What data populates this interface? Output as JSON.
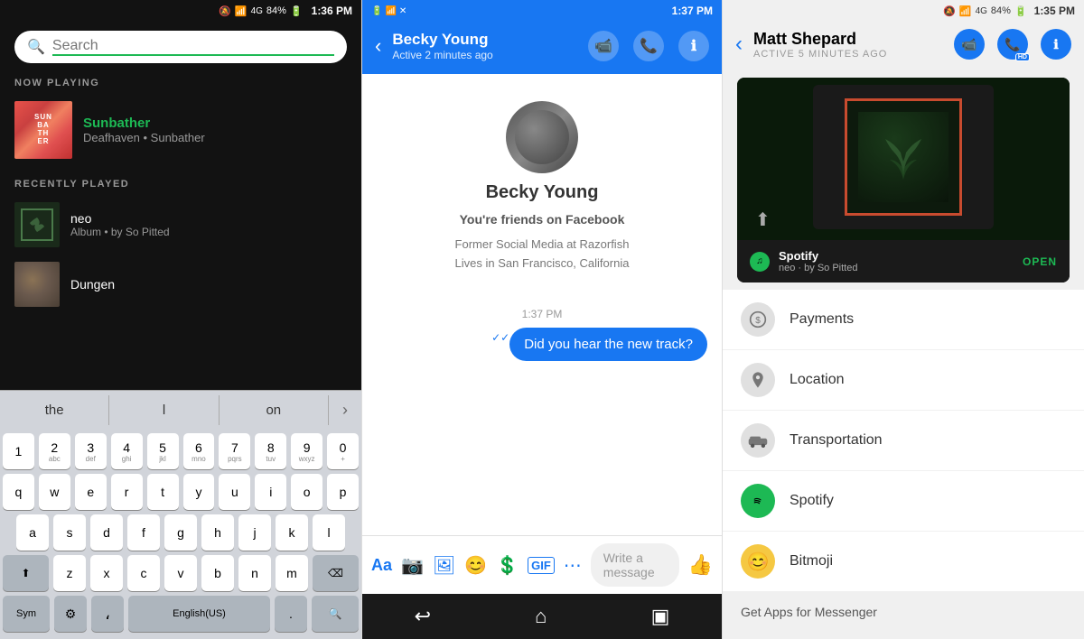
{
  "spotify": {
    "status_bar": {
      "time": "1:36 PM",
      "battery": "84%"
    },
    "search_placeholder": "Search",
    "now_playing_label": "NOW PLAYING",
    "track": {
      "title": "Sunbather",
      "artist": "Deafhaven",
      "album": "Sunbather",
      "art_text": "SUN\nBA\nTH\nER"
    },
    "recently_played_label": "RECENTLY PLAYED",
    "recent_tracks": [
      {
        "title": "neo",
        "subtitle": "Album • by So Pitted"
      },
      {
        "title": "Dungen",
        "subtitle": ""
      }
    ]
  },
  "keyboard": {
    "suggestions": [
      "the",
      "l",
      "on"
    ],
    "rows": [
      [
        "1",
        "2",
        "3",
        "4",
        "5",
        "6",
        "7",
        "8",
        "9",
        "0"
      ],
      [
        "q",
        "w",
        "e",
        "r",
        "t",
        "y",
        "u",
        "i",
        "o",
        "p"
      ],
      [
        "a",
        "s",
        "d",
        "f",
        "g",
        "h",
        "j",
        "k",
        "l"
      ],
      [
        "z",
        "x",
        "c",
        "v",
        "b",
        "n",
        "m"
      ],
      [
        "Sym",
        "⚙",
        "،",
        "English(US)",
        ".",
        "🔍"
      ]
    ]
  },
  "messenger": {
    "status_bar": {
      "time": "1:37 PM"
    },
    "contact_name": "Becky Young",
    "contact_status": "Active 2 minutes ago",
    "profile": {
      "name": "Becky Young",
      "friends_text": "You're friends on Facebook",
      "detail1": "Former Social Media at Razorfish",
      "detail2": "Lives in San Francisco, California"
    },
    "message_timestamp": "1:37 PM",
    "message_text": "Did you hear the new track?",
    "compose_placeholder": "Write a message",
    "back_label": "‹"
  },
  "matt": {
    "status_bar": {
      "time": "1:35 PM",
      "battery": "84%"
    },
    "contact_name": "Matt Shepard",
    "contact_status": "ACTIVE 5 MINUTES AGO",
    "spotify_card": {
      "title": "neo",
      "artist": "by So Pitted",
      "open_label": "OPEN",
      "spotify_label": "Spotify"
    },
    "list_items": [
      {
        "icon": "💲",
        "label": "Payments",
        "icon_type": "payments"
      },
      {
        "icon": "📍",
        "label": "Location",
        "icon_type": "location"
      },
      {
        "icon": "🚗",
        "label": "Transportation",
        "icon_type": "transportation"
      },
      {
        "icon": "♫",
        "label": "Spotify",
        "icon_type": "spotify"
      },
      {
        "icon": "😊",
        "label": "Bitmoji",
        "icon_type": "bitmoji"
      }
    ],
    "get_apps_text": "Get Apps for Messenger"
  }
}
